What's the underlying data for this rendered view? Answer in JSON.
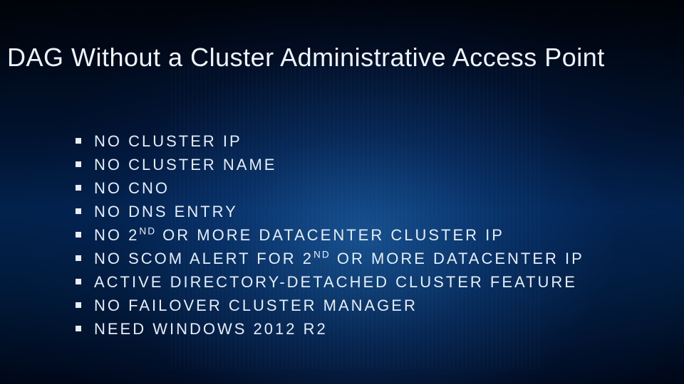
{
  "title": "DAG Without a Cluster Administrative Access Point",
  "bullets": [
    {
      "pre": "NO CLUSTER IP",
      "sup": "",
      "post": ""
    },
    {
      "pre": "NO CLUSTER NAME",
      "sup": "",
      "post": ""
    },
    {
      "pre": "NO CNO",
      "sup": "",
      "post": ""
    },
    {
      "pre": "NO DNS ENTRY",
      "sup": "",
      "post": ""
    },
    {
      "pre": "NO 2",
      "sup": "ND",
      "post": " OR MORE DATACENTER CLUSTER IP"
    },
    {
      "pre": "NO SCOM ALERT FOR 2",
      "sup": "ND",
      "post": " OR MORE DATACENTER IP"
    },
    {
      "pre": "ACTIVE DIRECTORY-DETACHED CLUSTER FEATURE",
      "sup": "",
      "post": ""
    },
    {
      "pre": "NO FAILOVER CLUSTER MANAGER",
      "sup": "",
      "post": ""
    },
    {
      "pre": "NEED WINDOWS 2012 R2",
      "sup": "",
      "post": ""
    }
  ]
}
